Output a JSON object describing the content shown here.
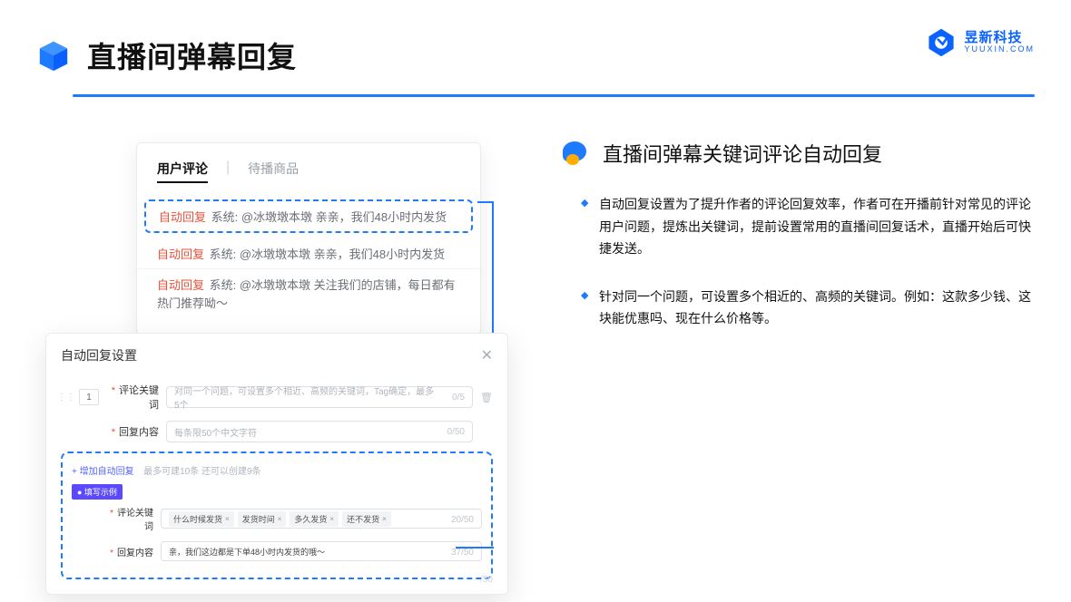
{
  "header": {
    "title": "直播间弹幕回复",
    "brand_cn": "昱新科技",
    "brand_en": "YUUXIN.COM"
  },
  "comments": {
    "tab_active": "用户评论",
    "tab_inactive": "待播商品",
    "auto_reply_label": "自动回复",
    "row1": "系统: @冰墩墩本墩 亲亲，我们48小时内发货",
    "row2": "系统: @冰墩墩本墩 亲亲，我们48小时内发货",
    "row3": "系统: @冰墩墩本墩 关注我们的店铺，每日都有热门推荐呦～"
  },
  "settings": {
    "title": "自动回复设置",
    "order_num": "1",
    "keyword_label": "评论关键词",
    "keyword_placeholder": "对同一个问题，可设置多个相近、高频的关键词，Tag确定，最多5个",
    "keyword_counter": "0/5",
    "content_label": "回复内容",
    "content_placeholder": "每条限50个中文字符",
    "content_counter": "0/50",
    "add_link": "+ 增加自动回复",
    "add_hint": "最多可建10条 还可以创建9条",
    "example_badge": "● 填写示例",
    "example_keyword_label": "评论关键词",
    "example_tags": [
      "什么时候发货",
      "发货时间",
      "多久发货",
      "还不发货"
    ],
    "example_keyword_counter": "20/50",
    "example_content_label": "回复内容",
    "example_content_value": "亲，我们这边都是下单48小时内发货的哦～",
    "example_content_counter": "37/50",
    "ghost_counter": "/50"
  },
  "right": {
    "title": "直播间弹幕关键词评论自动回复",
    "bullet1": "自动回复设置为了提升作者的评论回复效率，作者可在开播前针对常见的评论用户问题，提炼出关键词，提前设置常用的直播间回复话术，直播开始后可快捷发送。",
    "bullet2": "针对同一个问题，可设置多个相近的、高频的关键词。例如：这款多少钱、这块能优惠吗、现在什么价格等。"
  }
}
